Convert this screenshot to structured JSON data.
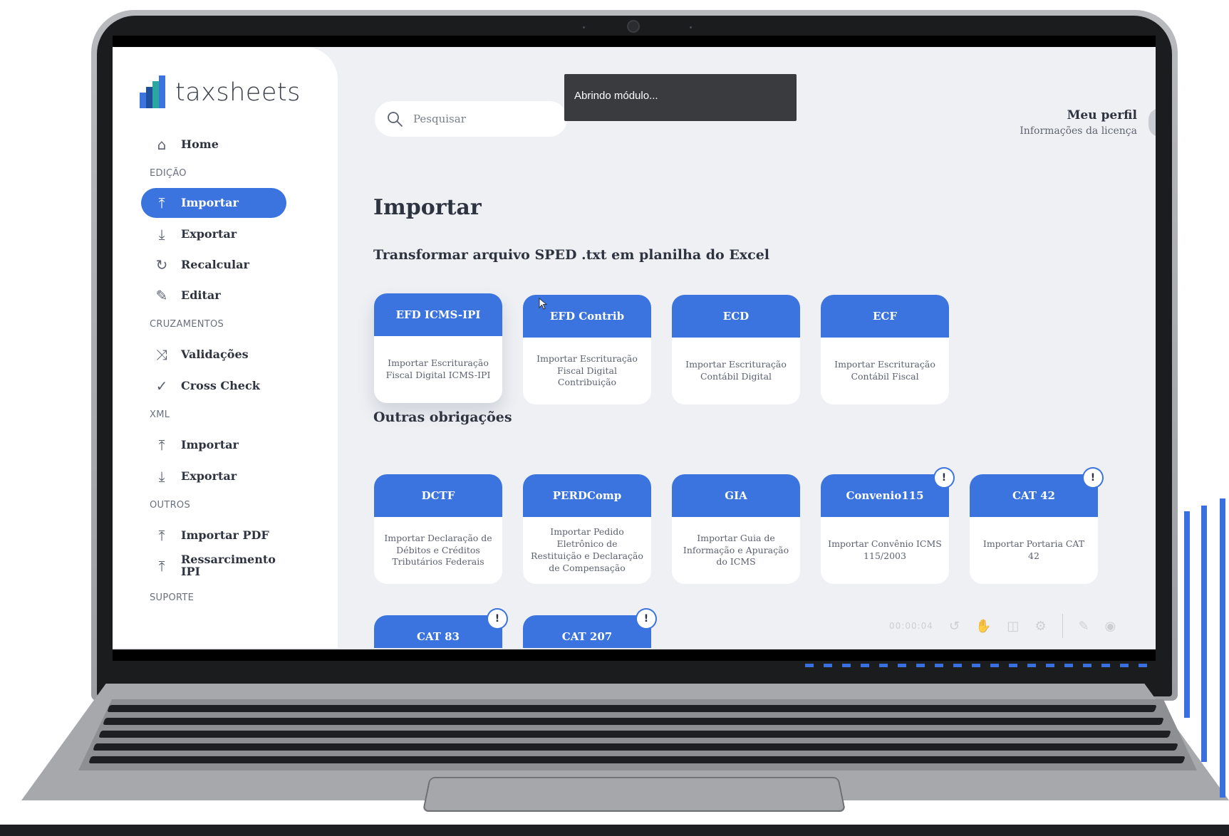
{
  "sidebar": {
    "logo": {
      "light": "tax",
      "regular": "sheets"
    },
    "home": "Home",
    "sections": {
      "edicao": "EDIÇÃO",
      "cruzamentos": "CRUZAMENTOS",
      "xml": "XML",
      "outros": "OUTROS",
      "suporte": "SUPORTE"
    },
    "items": [
      {
        "label": "Importar",
        "icon": "upload-icon"
      },
      {
        "label": "Exportar",
        "icon": "download-icon"
      },
      {
        "label": "Recalcular",
        "icon": "refresh-icon"
      },
      {
        "label": "Editar",
        "icon": "pencil-icon"
      },
      {
        "label": "Validações",
        "icon": "shuffle-icon"
      },
      {
        "label": "Cross Check",
        "icon": "check-icon"
      },
      {
        "label": "Importar",
        "icon": "upload-icon"
      },
      {
        "label": "Exportar",
        "icon": "download-icon"
      },
      {
        "label": "Importar PDF",
        "icon": "upload-icon"
      },
      {
        "label": "Ressarcimento IPI",
        "icon": "upload-icon"
      }
    ]
  },
  "header": {
    "search_placeholder": "Pesquisar",
    "toast": "Abrindo módulo...",
    "profile_name": "Meu perfil",
    "profile_sub": "Informações da licença"
  },
  "main": {
    "title": "Importar",
    "section1": "Transformar arquivo SPED .txt em planilha do Excel",
    "section2": "Outras obrigações",
    "sped_cards": [
      {
        "title": "EFD ICMS-IPI",
        "desc": "Importar Escrituração Fiscal Digital ICMS-IPI"
      },
      {
        "title": "EFD Contrib",
        "desc": "Importar Escrituração Fiscal Digital Contribuição"
      },
      {
        "title": "ECD",
        "desc": "Importar Escrituração Contábil Digital"
      },
      {
        "title": "ECF",
        "desc": "Importar Escrituração Contábil Fiscal"
      }
    ],
    "other_cards": [
      {
        "title": "DCTF",
        "desc": "Importar Declaração de Débitos e Créditos Tributários Federais"
      },
      {
        "title": "PERDComp",
        "desc": "Importar Pedido Eletrônico de Restituição e Declaração de Compensação"
      },
      {
        "title": "GIA",
        "desc": "Importar Guia de Informação e Apuração do ICMS"
      },
      {
        "title": "Convenio115",
        "desc": "Importar Convênio ICMS 115/2003",
        "badge": "!"
      },
      {
        "title": "CAT 42",
        "desc": "Importar Portaria CAT 42",
        "badge": "!"
      }
    ],
    "more_cards": [
      {
        "title": "CAT 83",
        "badge": "!"
      },
      {
        "title": "CAT 207",
        "badge": "!"
      }
    ]
  },
  "player": {
    "time": "00:00:04"
  },
  "colors": {
    "accent": "#3b74de",
    "logo": "#2aa8a0",
    "background": "#eef0f4"
  }
}
